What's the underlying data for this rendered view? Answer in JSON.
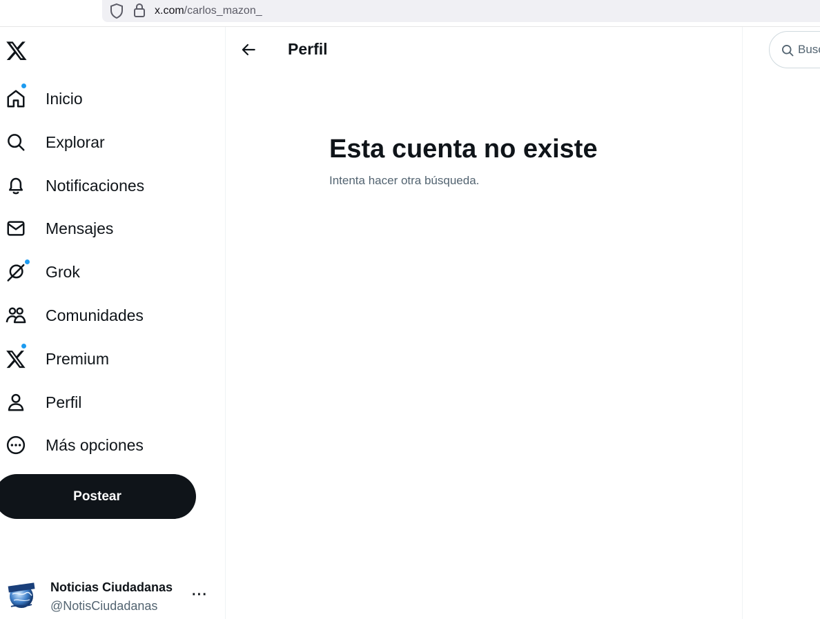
{
  "browser": {
    "url_host": "x.com",
    "url_path": "/carlos_mazon_"
  },
  "nav": {
    "items": [
      {
        "label": "Inicio",
        "icon": "home-icon",
        "badge": true
      },
      {
        "label": "Explorar",
        "icon": "search-icon",
        "badge": false
      },
      {
        "label": "Notificaciones",
        "icon": "bell-icon",
        "badge": false
      },
      {
        "label": "Mensajes",
        "icon": "envelope-icon",
        "badge": false
      },
      {
        "label": "Grok",
        "icon": "grok-icon",
        "badge": true
      },
      {
        "label": "Comunidades",
        "icon": "people-icon",
        "badge": false
      },
      {
        "label": "Premium",
        "icon": "x-logo-icon",
        "badge": true
      },
      {
        "label": "Perfil",
        "icon": "person-icon",
        "badge": false
      },
      {
        "label": "Más opciones",
        "icon": "more-circle-icon",
        "badge": false
      }
    ],
    "post_label": "Postear"
  },
  "account": {
    "name": "Noticias Ciudadanas",
    "handle": "@NotisCiudadanas",
    "more": "···"
  },
  "main": {
    "header_title": "Perfil",
    "empty_title": "Esta cuenta no existe",
    "empty_subtitle": "Intenta hacer otra búsqueda."
  },
  "search": {
    "placeholder": "Buscar"
  },
  "colors": {
    "accent": "#1d9bf0",
    "text": "#0f1419",
    "secondary": "#536471",
    "button": "#0f1419"
  }
}
